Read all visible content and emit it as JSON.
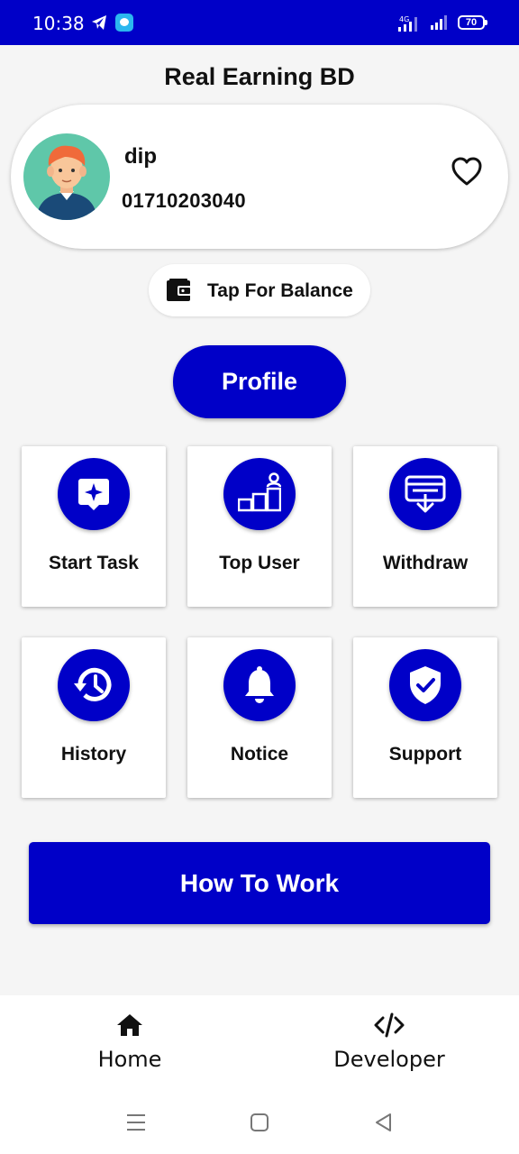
{
  "status_bar": {
    "time": "10:38",
    "network": "4G",
    "battery": "70"
  },
  "app": {
    "title": "Real Earning BD"
  },
  "user": {
    "name": "dip",
    "phone": "01710203040"
  },
  "balance_button": {
    "label": "Tap For Balance"
  },
  "profile_button": {
    "label": "Profile"
  },
  "tiles": [
    {
      "label": "Start Task",
      "icon": "star-task-icon"
    },
    {
      "label": "Top User",
      "icon": "leaderboard-icon"
    },
    {
      "label": "Withdraw",
      "icon": "withdraw-icon"
    },
    {
      "label": "History",
      "icon": "history-icon"
    },
    {
      "label": "Notice",
      "icon": "bell-icon"
    },
    {
      "label": "Support",
      "icon": "shield-check-icon"
    }
  ],
  "how_button": {
    "label": "How To Work"
  },
  "bottom_nav": [
    {
      "label": "Home",
      "icon": "home-icon"
    },
    {
      "label": "Developer",
      "icon": "code-icon"
    }
  ],
  "colors": {
    "primary": "#0000c8",
    "background": "#f5f5f5",
    "avatar_bg": "#5fc7a9"
  }
}
